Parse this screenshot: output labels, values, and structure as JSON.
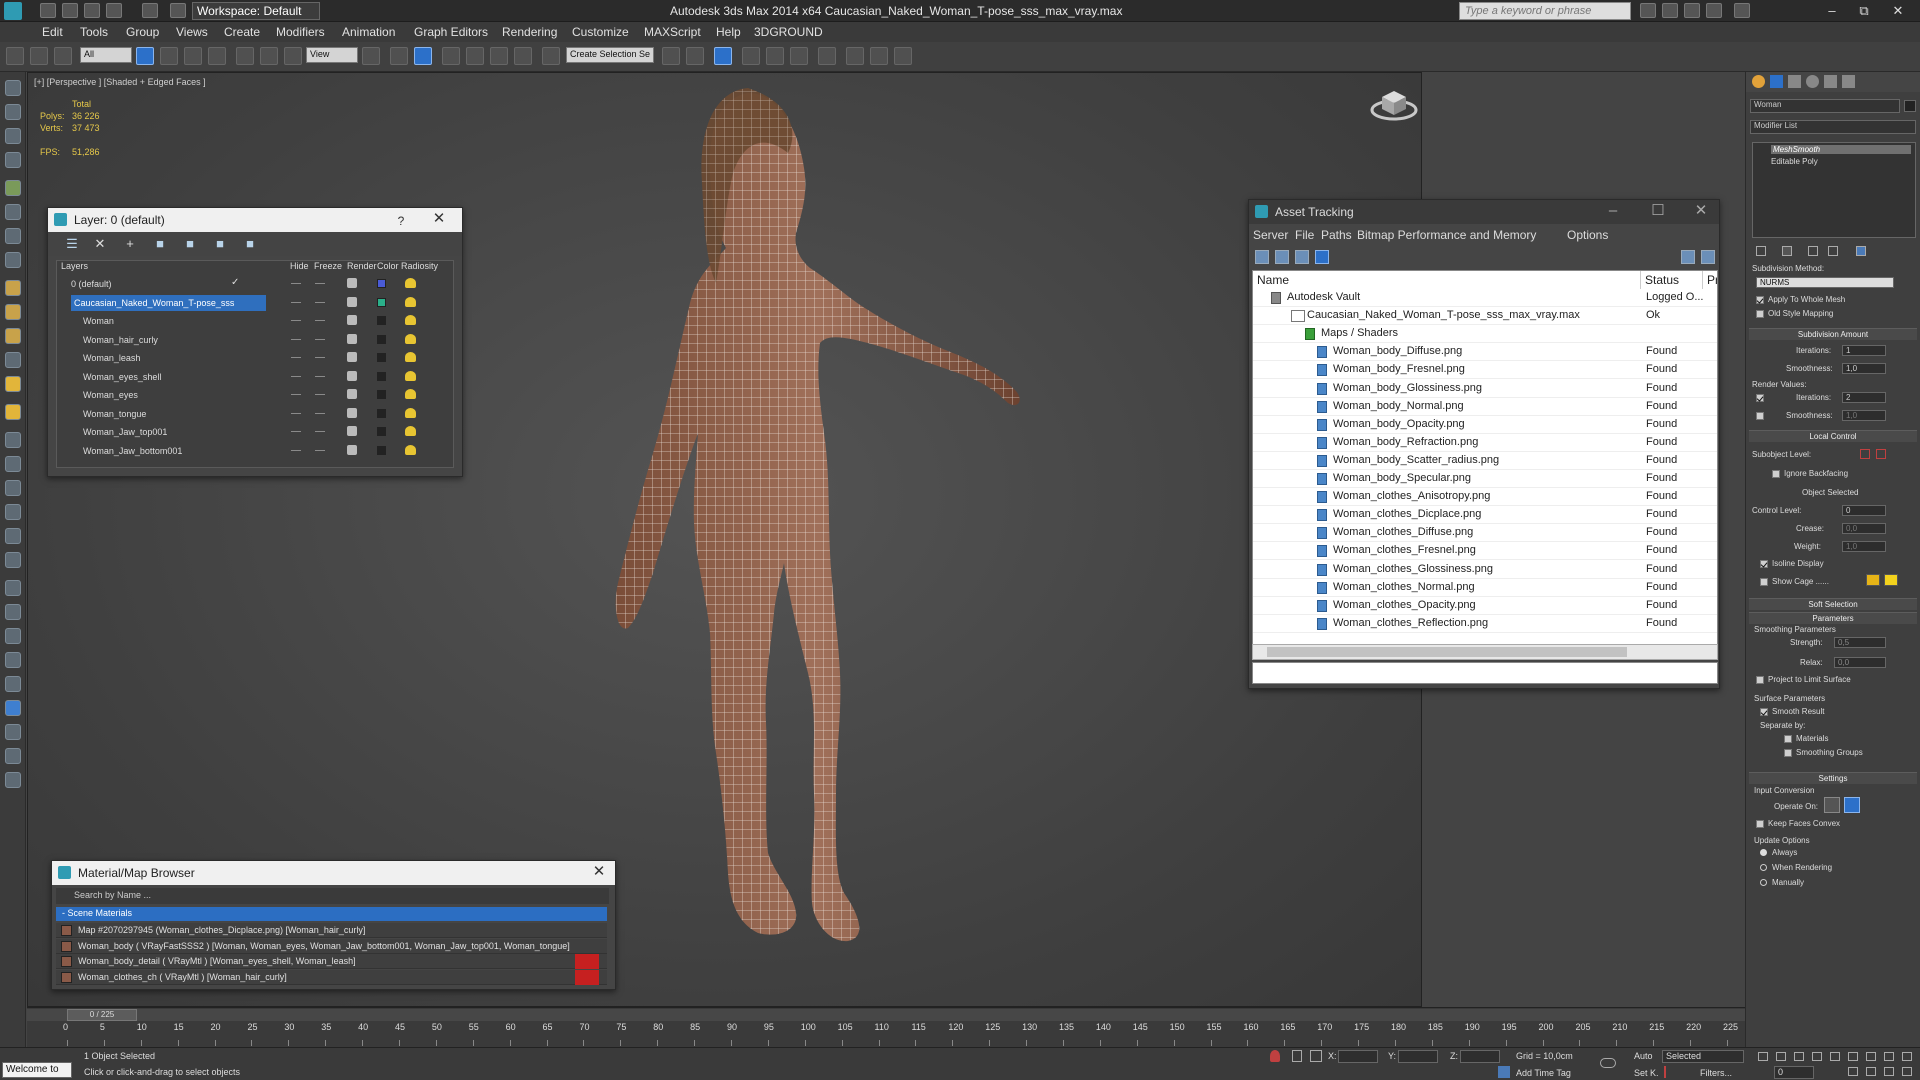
{
  "app": {
    "title": "Autodesk 3ds Max  2014 x64    Caucasian_Naked_Woman_T-pose_sss_max_vray.max",
    "workspace": "Workspace: Default",
    "search_placeholder": "Type a keyword or phrase"
  },
  "menu": [
    "Edit",
    "Tools",
    "Group",
    "Views",
    "Create",
    "Modifiers",
    "Animation",
    "Graph Editors",
    "Rendering",
    "Customize",
    "MAXScript",
    "Help",
    "3DGROUND"
  ],
  "toolbar": {
    "filter_select": "All",
    "refcoord_select": "View",
    "named_selection": "Create Selection Se"
  },
  "viewport": {
    "label": "[+] [Perspective ] [Shaded + Edged Faces ]",
    "stats_header": "Total",
    "polys_label": "Polys:",
    "polys_value": "36 226",
    "verts_label": "Verts:",
    "verts_value": "37 473",
    "fps_label": "FPS:",
    "fps_value": "51,286"
  },
  "layer_window": {
    "title": "Layer: 0 (default)",
    "help": "?",
    "columns": [
      "Layers",
      "Hide",
      "Freeze",
      "Render",
      "Color",
      "Radiosity"
    ],
    "rows": [
      {
        "name": "0 (default)",
        "color": "#4a5bd6"
      },
      {
        "name": "Caucasian_Naked_Woman_T-pose_sss",
        "color": "#2bb08a"
      },
      {
        "name": "Woman",
        "color": "#222"
      },
      {
        "name": "Woman_hair_curly",
        "color": "#222"
      },
      {
        "name": "Woman_leash",
        "color": "#222"
      },
      {
        "name": "Woman_eyes_shell",
        "color": "#222"
      },
      {
        "name": "Woman_eyes",
        "color": "#222"
      },
      {
        "name": "Woman_tongue",
        "color": "#222"
      },
      {
        "name": "Woman_Jaw_top001",
        "color": "#222"
      },
      {
        "name": "Woman_Jaw_bottom001",
        "color": "#222"
      }
    ]
  },
  "asset_window": {
    "title": "Asset Tracking",
    "menu": [
      "Server",
      "File",
      "Paths",
      "Bitmap Performance and Memory",
      "Options"
    ],
    "columns": [
      "Name",
      "Status",
      "Pro"
    ],
    "rows": [
      {
        "name": "Autodesk Vault",
        "status": "Logged O...",
        "indent": 0
      },
      {
        "name": "Caucasian_Naked_Woman_T-pose_sss_max_vray.max",
        "status": "Ok",
        "indent": 1
      },
      {
        "name": "Maps / Shaders",
        "status": "",
        "indent": 2
      },
      {
        "name": "Woman_body_Diffuse.png",
        "status": "Found",
        "indent": 3
      },
      {
        "name": "Woman_body_Fresnel.png",
        "status": "Found",
        "indent": 3
      },
      {
        "name": "Woman_body_Glossiness.png",
        "status": "Found",
        "indent": 3
      },
      {
        "name": "Woman_body_Normal.png",
        "status": "Found",
        "indent": 3
      },
      {
        "name": "Woman_body_Opacity.png",
        "status": "Found",
        "indent": 3
      },
      {
        "name": "Woman_body_Refraction.png",
        "status": "Found",
        "indent": 3
      },
      {
        "name": "Woman_body_Scatter_radius.png",
        "status": "Found",
        "indent": 3
      },
      {
        "name": "Woman_body_Specular.png",
        "status": "Found",
        "indent": 3
      },
      {
        "name": "Woman_clothes_Anisotropy.png",
        "status": "Found",
        "indent": 3
      },
      {
        "name": "Woman_clothes_Dicplace.png",
        "status": "Found",
        "indent": 3
      },
      {
        "name": "Woman_clothes_Diffuse.png",
        "status": "Found",
        "indent": 3
      },
      {
        "name": "Woman_clothes_Fresnel.png",
        "status": "Found",
        "indent": 3
      },
      {
        "name": "Woman_clothes_Glossiness.png",
        "status": "Found",
        "indent": 3
      },
      {
        "name": "Woman_clothes_Normal.png",
        "status": "Found",
        "indent": 3
      },
      {
        "name": "Woman_clothes_Opacity.png",
        "status": "Found",
        "indent": 3
      },
      {
        "name": "Woman_clothes_Reflection.png",
        "status": "Found",
        "indent": 3
      }
    ]
  },
  "material_window": {
    "title": "Material/Map Browser",
    "search": "Search by Name ...",
    "group": "- Scene Materials",
    "rows": [
      {
        "text": "Map #2070297945 (Woman_clothes_Dicplace.png) [Woman_hair_curly]",
        "red": false
      },
      {
        "text": "Woman_body  ( VRayFastSSS2 ) [Woman, Woman_eyes, Woman_Jaw_bottom001, Woman_Jaw_top001, Woman_tongue]",
        "red": false
      },
      {
        "text": "Woman_body_detail  ( VRayMtl ) [Woman_eyes_shell, Woman_leash]",
        "red": true
      },
      {
        "text": "Woman_clothes_ch  ( VRayMtl ) [Woman_hair_curly]",
        "red": true
      }
    ]
  },
  "command_panel": {
    "object_name": "Woman",
    "modifier_list": "Modifier List",
    "stack": [
      "MeshSmooth",
      "Editable Poly"
    ],
    "subdiv_method_label": "Subdivision Method:",
    "subdiv_method": "NURMS",
    "apply_whole": "Apply To Whole Mesh",
    "old_style": "Old Style Mapping",
    "subdiv_amount": "Subdivision Amount",
    "iterations_label": "Iterations:",
    "iterations": "1",
    "smoothness_label": "Smoothness:",
    "smoothness": "1,0",
    "render_values": "Render Values:",
    "r_iterations": "2",
    "r_smoothness": "1,0",
    "local_control": "Local Control",
    "subobject_level": "Subobject Level:",
    "ignore_backfacing": "Ignore Backfacing",
    "object_selected": "Object Selected",
    "control_level": "Control Level:",
    "control_level_value": "0",
    "crease": "Crease:",
    "crease_value": "0,0",
    "weight": "Weight:",
    "weight_value": "1,0",
    "isoline": "Isoline Display",
    "show_cage": "Show Cage ......",
    "soft_selection": "Soft Selection",
    "parameters": "Parameters",
    "smoothing_params": "Smoothing Parameters",
    "strength": "Strength:",
    "strength_value": "0,5",
    "relax": "Relax:",
    "relax_value": "0,0",
    "project_limit": "Project to Limit Surface",
    "surface_params": "Surface Parameters",
    "smooth_result": "Smooth Result",
    "separate_by": "Separate by:",
    "materials": "Materials",
    "smoothing_groups": "Smoothing Groups",
    "settings": "Settings",
    "input_conversion": "Input Conversion",
    "operate_on": "Operate On:",
    "keep_convex": "Keep Faces Convex",
    "update_options": "Update Options",
    "always": "Always",
    "when_rendering": "When Rendering",
    "manually": "Manually"
  },
  "timeline": {
    "frame": "0 / 225",
    "ticks": [
      "0",
      "5",
      "10",
      "15",
      "20",
      "25",
      "30",
      "35",
      "40",
      "45",
      "50",
      "55",
      "60",
      "65",
      "70",
      "75",
      "80",
      "85",
      "90",
      "95",
      "100",
      "105",
      "110",
      "115",
      "120",
      "125",
      "130",
      "135",
      "140",
      "145",
      "150",
      "155",
      "160",
      "165",
      "170",
      "175",
      "180",
      "185",
      "190",
      "195",
      "200",
      "205",
      "210",
      "215",
      "220",
      "225"
    ]
  },
  "status": {
    "welcome": "Welcome to",
    "selected": "1 Object Selected",
    "prompt": "Click or click-and-drag to select objects",
    "x": "X:",
    "y": "Y:",
    "z": "Z:",
    "grid": "Grid = 10,0cm",
    "add_time_tag": "Add Time Tag",
    "auto": "Auto",
    "setk": "Set K.",
    "selected_select": "Selected",
    "filters": "Filters...",
    "frame_field": "0"
  }
}
